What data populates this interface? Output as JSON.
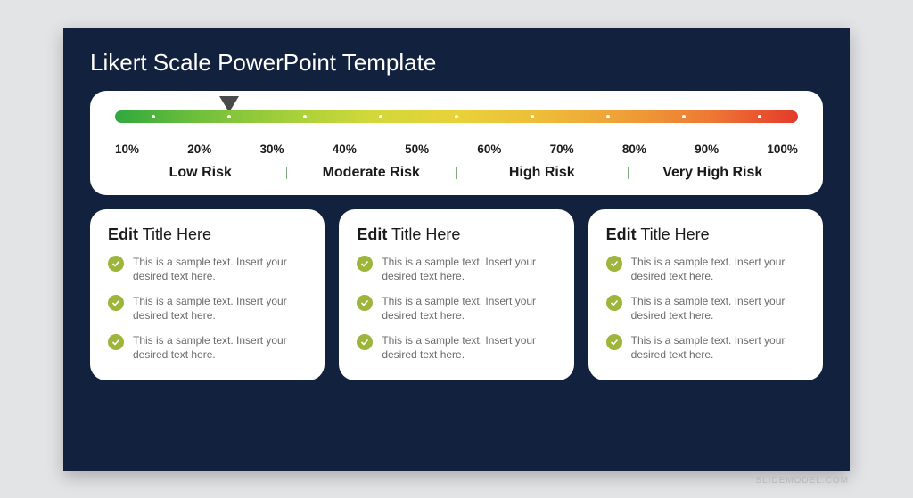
{
  "title": "Likert Scale PowerPoint Template",
  "scale": {
    "pointer_percent": 25,
    "ticks": [
      "10%",
      "20%",
      "30%",
      "40%",
      "50%",
      "60%",
      "70%",
      "80%",
      "90%",
      "100%"
    ],
    "risk_labels": [
      "Low Risk",
      "Moderate Risk",
      "High Risk",
      "Very High Risk"
    ]
  },
  "cards": [
    {
      "title_bold": "Edit",
      "title_rest": " Title Here",
      "bullets": [
        "This is a sample text. Insert your desired text here.",
        "This is a sample text. Insert your desired text here.",
        "This is a sample text. Insert your desired text here."
      ]
    },
    {
      "title_bold": "Edit",
      "title_rest": " Title Here",
      "bullets": [
        "This is a sample text. Insert your desired text here.",
        "This is a sample text. Insert your desired text here.",
        "This is a sample text. Insert your desired text here."
      ]
    },
    {
      "title_bold": "Edit",
      "title_rest": " Title Here",
      "bullets": [
        "This is a sample text. Insert your desired text here.",
        "This is a sample text. Insert your desired text here.",
        "This is a sample text. Insert your desired text here."
      ]
    }
  ],
  "attribution": "SLIDEMODEL.COM",
  "colors": {
    "slide_bg": "#12213d",
    "bullet_check": "#9db53a"
  }
}
